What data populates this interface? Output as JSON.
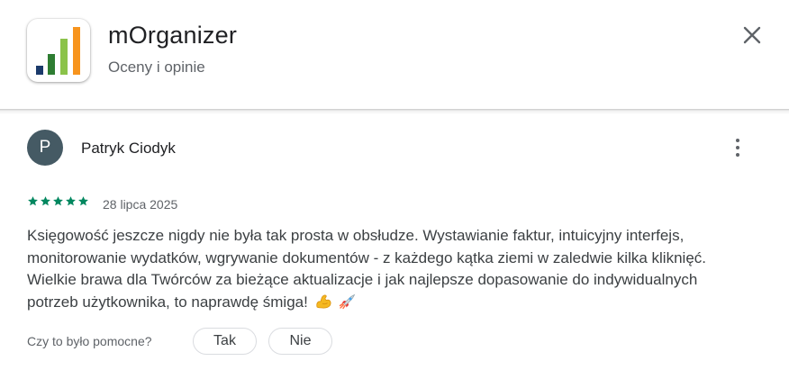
{
  "app": {
    "title": "mOrganizer",
    "subtitle": "Oceny i opinie",
    "icon": "bar-chart-logo",
    "logo_colors": [
      "#1b3a6b",
      "#2e7d32",
      "#8bc34a",
      "#f7941d"
    ]
  },
  "review": {
    "author_initial": "P",
    "author_name": "Patryk Ciodyk",
    "rating": 5,
    "star_color": "#01875f",
    "date": "28 lipca 2025",
    "text_lines": [
      "Księgowość jeszcze nigdy nie była tak prosta w obsłudze. Wystawianie faktur, intuicyjny interfejs,",
      "monitorowanie wydatków, wgrywanie dokumentów - z każdego kątka ziemi w zaledwie kilka kliknięć.",
      "Wielkie brawa dla Twórców za bieżące aktualizacje i jak najlepsze dopasowanie do indywidualnych",
      "potrzeb użytkownika, to naprawdę śmiga!"
    ],
    "emojis": [
      "flexed-biceps-emoji",
      "rocket-emoji"
    ]
  },
  "helpful": {
    "question": "Czy to było pomocne?",
    "yes_label": "Tak",
    "no_label": "Nie"
  },
  "colors": {
    "avatar_bg": "#455a64",
    "pill_border": "#dadce0"
  }
}
